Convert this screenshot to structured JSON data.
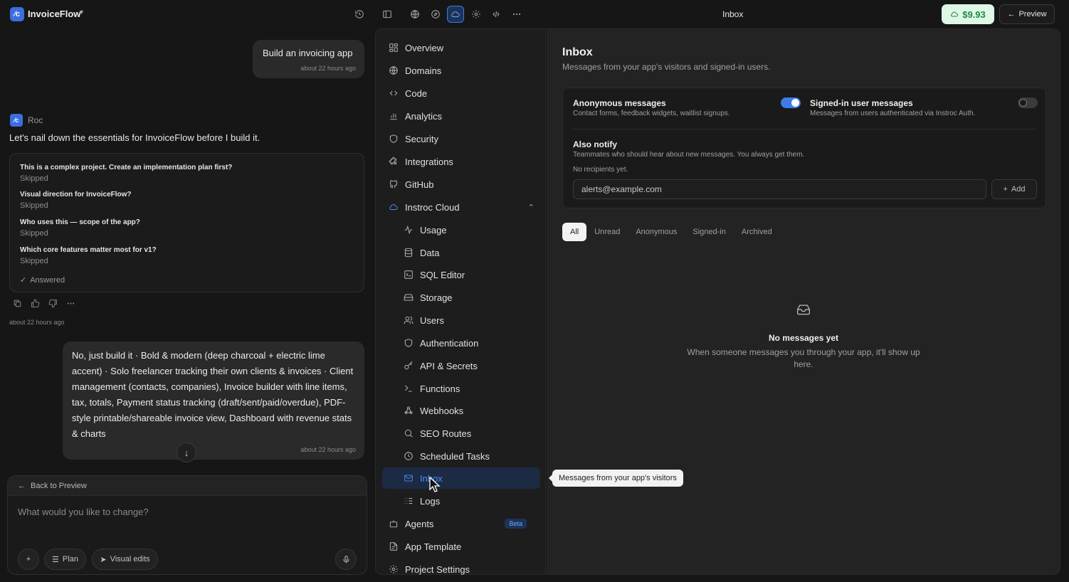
{
  "app": {
    "logo_glyph": "⁄c",
    "name": "InvoiceFlow",
    "page_title": "Inbox",
    "credits": "$9.93",
    "preview_label": "Preview"
  },
  "chat": {
    "user_msg_1": "Build an invoicing app",
    "user_msg_1_time": "about 22 hours ago",
    "assistant_name": "Roc",
    "assistant_msg": "Let's nail down the essentials for InvoiceFlow before I build it.",
    "questions": [
      {
        "q": "This is a complex project. Create an implementation plan first?",
        "a": "Skipped"
      },
      {
        "q": "Visual direction for InvoiceFlow?",
        "a": "Skipped"
      },
      {
        "q": "Who uses this — scope of the app?",
        "a": "Skipped"
      },
      {
        "q": "Which core features matter most for v1?",
        "a": "Skipped"
      }
    ],
    "answered_label": "Answered",
    "assistant_time": "about 22 hours ago",
    "user_msg_2": "No, just build it · Bold & modern (deep charcoal + electric lime accent) · Solo freelancer tracking their own clients & invoices · Client management (contacts, companies), Invoice builder with line items, tax, totals, Payment status tracking (draft/sent/paid/overdue), PDF-style printable/shareable invoice view, Dashboard with revenue stats & charts",
    "user_msg_2_time": "about 22 hours ago",
    "back_label": "Back to Preview",
    "placeholder": "What would you like to change?",
    "plan_label": "Plan",
    "visual_edits_label": "Visual edits"
  },
  "nav": {
    "items": [
      {
        "label": "Overview",
        "icon": "overview-icon"
      },
      {
        "label": "Domains",
        "icon": "globe-icon"
      },
      {
        "label": "Code",
        "icon": "code-icon"
      },
      {
        "label": "Analytics",
        "icon": "bar-chart-icon"
      },
      {
        "label": "Security",
        "icon": "shield-icon"
      },
      {
        "label": "Integrations",
        "icon": "puzzle-icon"
      },
      {
        "label": "GitHub",
        "icon": "github-icon"
      },
      {
        "label": "Instroc Cloud",
        "icon": "cloud-icon"
      }
    ],
    "cloud_items": [
      {
        "label": "Usage",
        "icon": "activity-icon"
      },
      {
        "label": "Data",
        "icon": "database-icon"
      },
      {
        "label": "SQL Editor",
        "icon": "terminal-square-icon"
      },
      {
        "label": "Storage",
        "icon": "hard-drive-icon"
      },
      {
        "label": "Users",
        "icon": "users-icon"
      },
      {
        "label": "Authentication",
        "icon": "shield-icon"
      },
      {
        "label": "API & Secrets",
        "icon": "key-icon"
      },
      {
        "label": "Functions",
        "icon": "prompt-icon"
      },
      {
        "label": "Webhooks",
        "icon": "webhook-icon"
      },
      {
        "label": "SEO Routes",
        "icon": "search-icon"
      },
      {
        "label": "Scheduled Tasks",
        "icon": "clock-icon"
      },
      {
        "label": "Inbox",
        "icon": "mail-icon"
      },
      {
        "label": "Logs",
        "icon": "logs-icon"
      }
    ],
    "bottom_items": [
      {
        "label": "Agents",
        "icon": "bot-icon",
        "badge": "Beta"
      },
      {
        "label": "App Template",
        "icon": "file-icon"
      },
      {
        "label": "Project Settings",
        "icon": "gear-icon"
      }
    ],
    "tooltip": "Messages from your app's visitors"
  },
  "inbox": {
    "title": "Inbox",
    "subtitle": "Messages from your app's visitors and signed-in users.",
    "anon_title": "Anonymous messages",
    "anon_desc": "Contact forms, feedback widgets, waitlist signups.",
    "anon_enabled": true,
    "signed_title": "Signed-in user messages",
    "signed_desc": "Messages from users authenticated via Instroc Auth.",
    "signed_enabled": false,
    "notify_title": "Also notify",
    "notify_desc": "Teammates who should hear about new messages. You always get them.",
    "no_recipients": "No recipients yet.",
    "email_placeholder": "alerts@example.com",
    "add_label": "Add",
    "tabs": [
      "All",
      "Unread",
      "Anonymous",
      "Signed-in",
      "Archived"
    ],
    "empty_title": "No messages yet",
    "empty_desc": "When someone messages you through your app, it'll show up here."
  },
  "colors": {
    "accent": "#3c7de8",
    "credit_bg": "#dff7e6",
    "credit_text": "#1f8a44"
  }
}
